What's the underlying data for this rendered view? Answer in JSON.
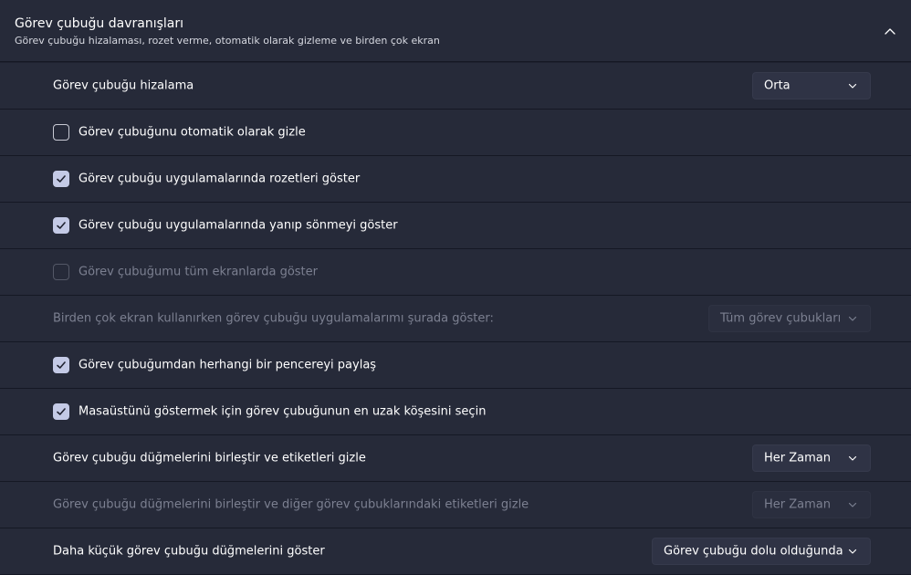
{
  "section": {
    "title": "Görev çubuğu davranışları",
    "subtitle": "Görev çubuğu hizalaması, rozet verme, otomatik olarak gizleme ve birden çok ekran",
    "expanded": true
  },
  "rows": {
    "alignment": {
      "label": "Görev çubuğu hizalama",
      "value": "Orta"
    },
    "autohide": {
      "label": "Görev çubuğunu otomatik olarak gizle",
      "checked": false
    },
    "badges": {
      "label": "Görev çubuğu uygulamalarında rozetleri göster",
      "checked": true
    },
    "flashing": {
      "label": "Görev çubuğu uygulamalarında yanıp sönmeyi göster",
      "checked": true
    },
    "all_displays": {
      "label": "Görev çubuğumu tüm ekranlarda göster",
      "checked": false,
      "disabled": true
    },
    "multi_display": {
      "label": "Birden çok ekran kullanırken görev çubuğu uygulamalarımı şurada göster:",
      "value": "Tüm görev çubukları",
      "disabled": true
    },
    "share_window": {
      "label": "Görev çubuğumdan herhangi bir pencereyi paylaş",
      "checked": true
    },
    "far_corner": {
      "label": "Masaüstünü göstermek için görev çubuğunun en uzak köşesini seçin",
      "checked": true
    },
    "combine_main": {
      "label": "Görev çubuğu düğmelerini birleştir ve etiketleri gizle",
      "value": "Her Zaman"
    },
    "combine_other": {
      "label": "Görev çubuğu düğmelerini birleştir ve diğer görev çubuklarındaki etiketleri gizle",
      "value": "Her Zaman",
      "disabled": true
    },
    "small_buttons": {
      "label": "Daha küçük görev çubuğu düğmelerini göster",
      "value": "Görev çubuğu dolu olduğunda"
    }
  },
  "colors": {
    "background": "#1f2230",
    "card": "#262a39",
    "checkbox_checked": "#c4cae6",
    "disabled_text": "#7c8091"
  }
}
